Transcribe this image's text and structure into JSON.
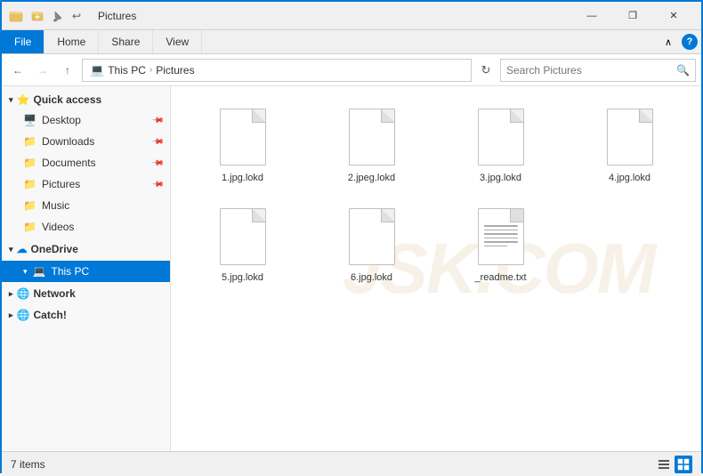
{
  "titleBar": {
    "title": "Pictures",
    "quickAccess": [
      "📁",
      "📌",
      "↩"
    ],
    "controls": {
      "minimize": "—",
      "maximize": "❐",
      "close": "✕"
    }
  },
  "ribbon": {
    "tabs": [
      "File",
      "Home",
      "Share",
      "View"
    ],
    "activeTab": "Home",
    "chevronLabel": "∧",
    "helpLabel": "?"
  },
  "addressBar": {
    "back": "←",
    "forward": "→",
    "up": "↑",
    "pathIcon": "📁",
    "segments": [
      "This PC",
      "Pictures"
    ],
    "refresh": "↻",
    "searchPlaceholder": "Search Pictures",
    "searchIcon": "🔍"
  },
  "sidebar": {
    "sections": [
      {
        "header": "Quick access",
        "icon": "⭐",
        "items": [
          {
            "label": "Desktop",
            "icon": "🖥️",
            "pinned": true
          },
          {
            "label": "Downloads",
            "icon": "📁",
            "pinned": true
          },
          {
            "label": "Documents",
            "icon": "📁",
            "pinned": true
          },
          {
            "label": "Pictures",
            "icon": "📁",
            "pinned": true
          },
          {
            "label": "Music",
            "icon": "📁",
            "pinned": false
          },
          {
            "label": "Videos",
            "icon": "📁",
            "pinned": false
          }
        ]
      },
      {
        "header": "OneDrive",
        "icon": "☁️",
        "items": []
      },
      {
        "header": "This PC",
        "icon": "💻",
        "items": [],
        "active": true
      },
      {
        "header": "Network",
        "icon": "🌐",
        "items": []
      },
      {
        "header": "Catch!",
        "icon": "🌐",
        "items": []
      }
    ]
  },
  "files": [
    {
      "name": "1.jpg.lokd",
      "type": "generic"
    },
    {
      "name": "2.jpeg.lokd",
      "type": "generic"
    },
    {
      "name": "3.jpg.lokd",
      "type": "generic"
    },
    {
      "name": "4.jpg.lokd",
      "type": "generic"
    },
    {
      "name": "5.jpg.lokd",
      "type": "generic"
    },
    {
      "name": "6.jpg.lokd",
      "type": "generic"
    },
    {
      "name": "_readme.txt",
      "type": "text"
    }
  ],
  "statusBar": {
    "itemCount": "7 items",
    "listViewIcon": "☰",
    "gridViewIcon": "⊞"
  },
  "watermark": "JSK.COM"
}
